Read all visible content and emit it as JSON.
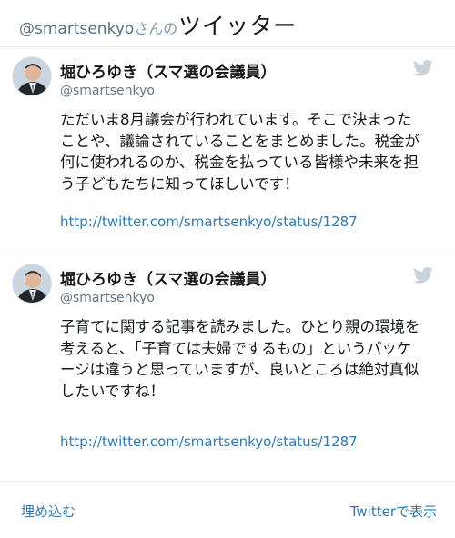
{
  "header": {
    "handle": "@smartsenkyo",
    "suffix": "さんの",
    "title": "ツイッター"
  },
  "tweets": [
    {
      "author_name": "堀ひろゆき（スマ選の会議員）",
      "author_handle": "@smartsenkyo",
      "text": "ただいま8月議会が行われています。そこで決まったことや、議論されていることをまとめました。税金が何に使われるのか、税金を払っている皆様や未来を担う子どもたちに知ってほしいです！",
      "link": "http://twitter.com/smartsenkyo/status/1287"
    },
    {
      "author_name": "堀ひろゆき（スマ選の会議員）",
      "author_handle": "@smartsenkyo",
      "text": "子育てに関する記事を読みました。ひとり親の環境を考えると、「子育ては夫婦でするもの」というパッケージは違うと思っていますが、良いところは絶対真似したいですね！",
      "link": "http://twitter.com/smartsenkyo/status/1287"
    }
  ],
  "footer": {
    "embed_label": "埋め込む",
    "view_label": "Twitterで表示"
  },
  "colors": {
    "link": "#2b7bb9",
    "divider": "#e6ecf0",
    "bird_icon": "#c8d3dc"
  },
  "icons": {
    "tweet_brand": "twitter-bird-icon",
    "avatar": "avatar"
  }
}
